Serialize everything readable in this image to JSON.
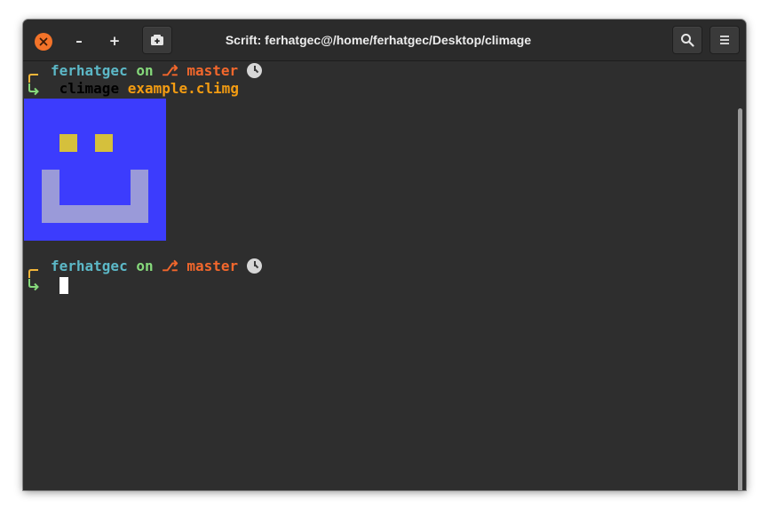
{
  "window": {
    "title": "Scrift: ferhatgec@/home/ferhatgec/Desktop/climage",
    "controls": {
      "minimize_label": "–",
      "maximize_label": "+"
    }
  },
  "terminal": {
    "prompts": [
      {
        "user": "ferhatgec",
        "on": "on",
        "branch_symbol": "⎇",
        "branch": "master",
        "command": "climage",
        "argument": "example.climg"
      },
      {
        "user": "ferhatgec",
        "on": "on",
        "branch_symbol": "⎇",
        "branch": "master",
        "command": "",
        "argument": ""
      }
    ],
    "image_output": {
      "background_color": "#3c3cfd",
      "eye_color": "#d5c03c",
      "mouth_color": "#9a9ad9"
    }
  },
  "icons": {
    "close": "close-icon",
    "new_tab": "new-tab-icon",
    "search": "search-icon",
    "menu": "hamburger-menu-icon",
    "clock": "clock-icon"
  },
  "colors": {
    "user": "#5cb8c7",
    "keyword": "#86d97b",
    "branch": "#f2672c",
    "argument": "#f39c12",
    "bracket_top": "#f3b63a",
    "bracket_bottom": "#86d97b"
  }
}
